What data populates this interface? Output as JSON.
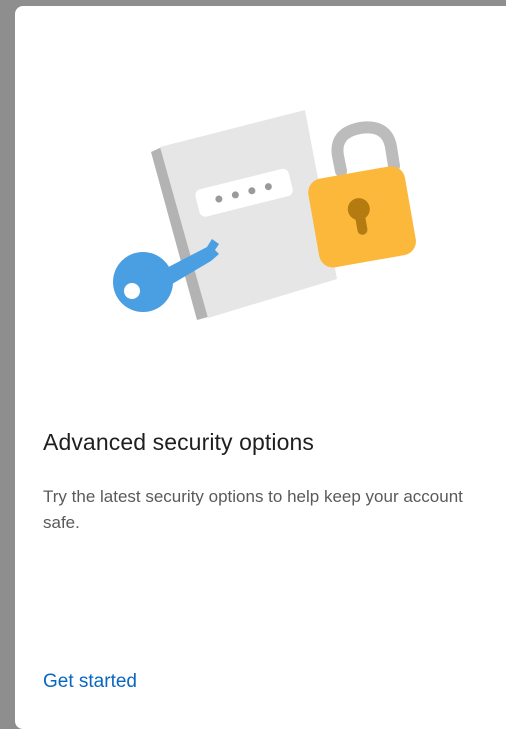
{
  "card": {
    "title": "Advanced security options",
    "description": "Try the latest security options to help keep your account safe.",
    "cta_label": "Get started"
  },
  "illustration": {
    "icons": [
      "password-book-icon",
      "key-icon",
      "padlock-icon"
    ],
    "colors": {
      "book": "#e6e6e6",
      "book_spine": "#b3b3b3",
      "key": "#4a9fe3",
      "lock_body": "#fbb83a",
      "lock_shackle": "#bcbcbc",
      "keyhole": "#b47b11"
    }
  },
  "colors": {
    "title": "#1f1f1f",
    "description": "#5a5a5a",
    "link": "#0a67c1",
    "card_background": "#ffffff",
    "backdrop": "#8e8e8e"
  }
}
